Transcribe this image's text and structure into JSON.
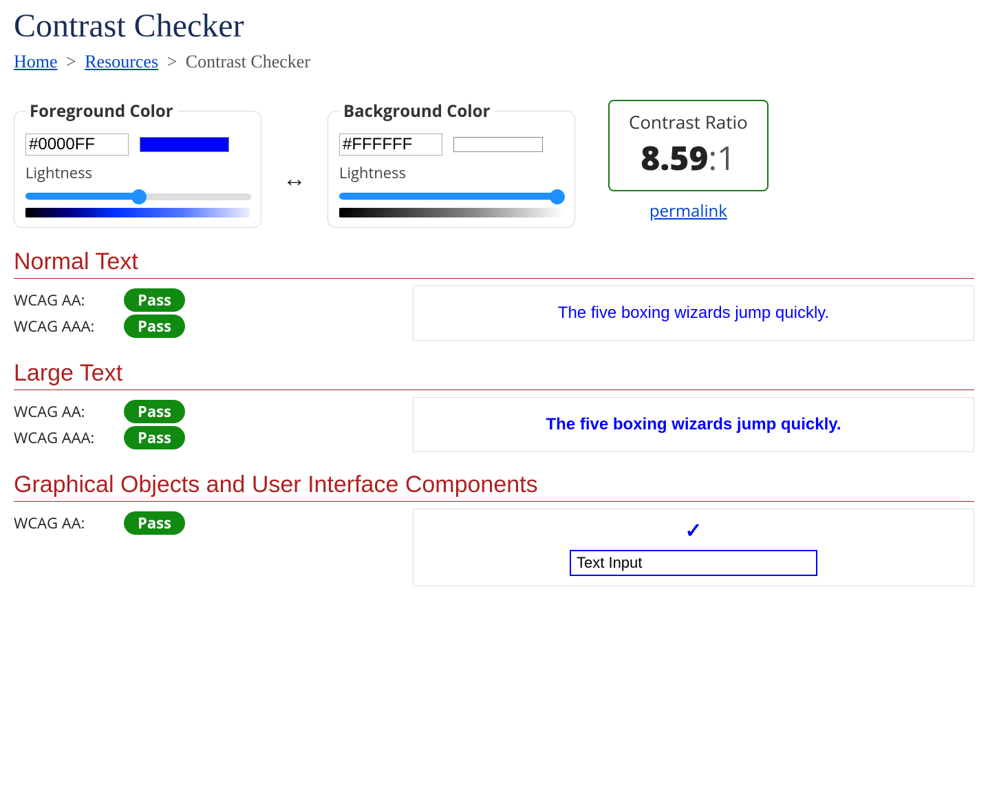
{
  "title": "Contrast Checker",
  "breadcrumb": {
    "home": "Home",
    "resources": "Resources",
    "current": "Contrast Checker"
  },
  "foreground": {
    "legend": "Foreground Color",
    "hex": "#0000FF",
    "lightness_label": "Lightness",
    "lightness_value": 50
  },
  "background": {
    "legend": "Background Color",
    "hex": "#FFFFFF",
    "lightness_label": "Lightness",
    "lightness_value": 100
  },
  "ratio": {
    "title": "Contrast Ratio",
    "value_bold": "8.59",
    "value_suffix": ":1",
    "permalink": "permalink"
  },
  "sections": {
    "normal": {
      "title": "Normal Text",
      "aa_label": "WCAG AA:",
      "aa_result": "Pass",
      "aaa_label": "WCAG AAA:",
      "aaa_result": "Pass",
      "sample": "The five boxing wizards jump quickly."
    },
    "large": {
      "title": "Large Text",
      "aa_label": "WCAG AA:",
      "aa_result": "Pass",
      "aaa_label": "WCAG AAA:",
      "aaa_result": "Pass",
      "sample": "The five boxing wizards jump quickly."
    },
    "ui": {
      "title": "Graphical Objects and User Interface Components",
      "aa_label": "WCAG AA:",
      "aa_result": "Pass",
      "input_value": "Text Input"
    }
  }
}
